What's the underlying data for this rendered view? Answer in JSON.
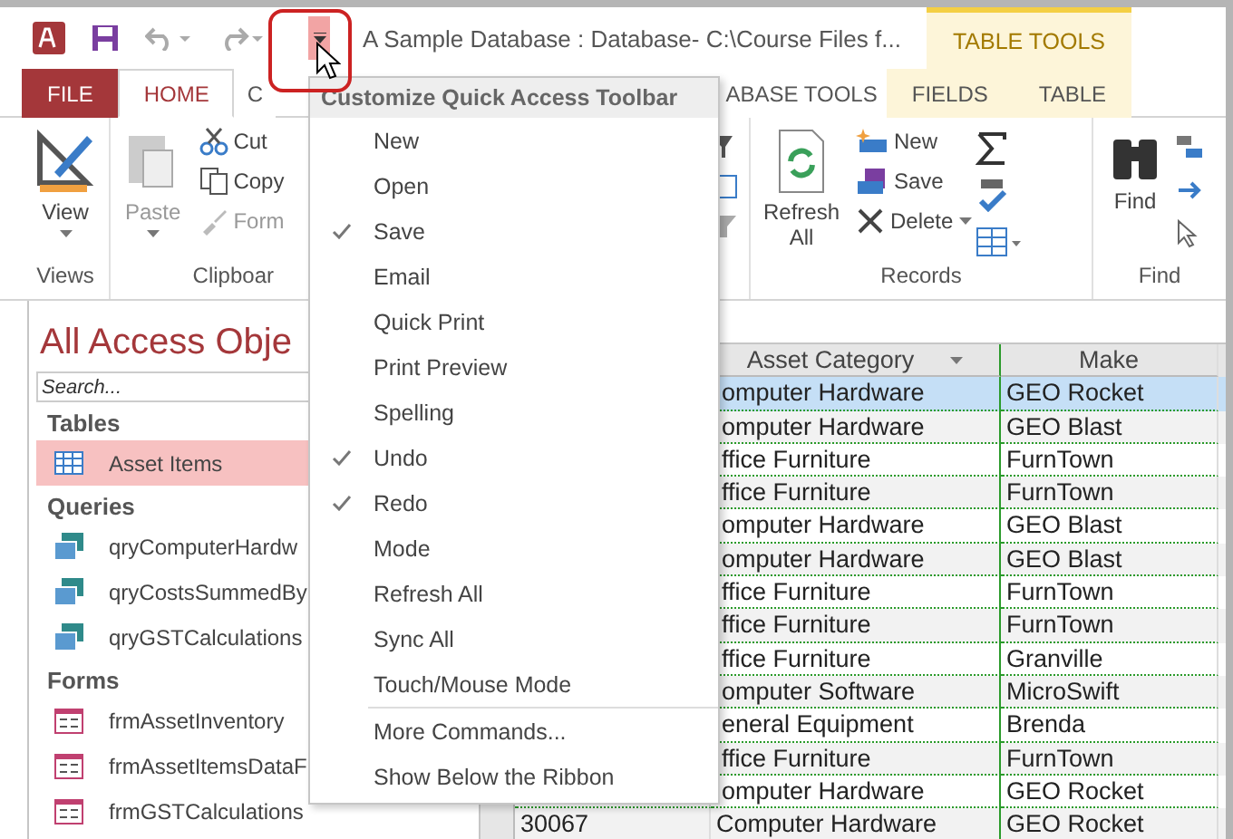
{
  "window": {
    "title": "A Sample Database : Database- C:\\Course Files f..."
  },
  "contextual_tab_group": {
    "label": "TABLE TOOLS"
  },
  "tabs": [
    {
      "label": "FILE",
      "selected": false,
      "kind": "file"
    },
    {
      "label": "HOME",
      "selected": true,
      "kind": "standard"
    },
    {
      "label": "C",
      "selected": false,
      "kind": "standard"
    },
    {
      "label": "ABASE TOOLS",
      "selected": false,
      "kind": "standard"
    },
    {
      "label": "FIELDS",
      "selected": false,
      "kind": "contextual"
    },
    {
      "label": "TABLE",
      "selected": false,
      "kind": "contextual"
    }
  ],
  "ribbon": {
    "views": {
      "label": "Views",
      "view_button": "View"
    },
    "clipboard": {
      "label": "Clipboar",
      "paste_button": "Paste",
      "cut_button": "Cut",
      "copy_button": "Copy",
      "format_button": "Form"
    },
    "records": {
      "label": "Records",
      "refresh_button": "Refresh All",
      "new_button": "New",
      "save_button": "Save",
      "delete_button": "Delete"
    },
    "find": {
      "label": "Find",
      "find_button": "Find"
    }
  },
  "navigation_pane": {
    "title": "All Access Obje",
    "search": {
      "placeholder": "Search..."
    },
    "sections": [
      {
        "title": "Tables",
        "items": [
          {
            "name": "Asset Items",
            "kind": "table",
            "selected": true
          }
        ]
      },
      {
        "title": "Queries",
        "items": [
          {
            "name": "qryComputerHardw",
            "kind": "query",
            "selected": false
          },
          {
            "name": "qryCostsSummedBy",
            "kind": "query",
            "selected": false
          },
          {
            "name": "qryGSTCalculations",
            "kind": "query",
            "selected": false
          }
        ]
      },
      {
        "title": "Forms",
        "items": [
          {
            "name": "frmAssetInventory",
            "kind": "form",
            "selected": false
          },
          {
            "name": "frmAssetItemsDataF",
            "kind": "form",
            "selected": false
          },
          {
            "name": "frmGSTCalculations",
            "kind": "form",
            "selected": false
          }
        ]
      }
    ]
  },
  "datasheet": {
    "columns": [
      "Asset Category",
      "Make"
    ],
    "rows": [
      {
        "asset_category": "omputer Hardware",
        "make": "GEO Rocket",
        "selected": true
      },
      {
        "asset_category": "omputer Hardware",
        "make": "GEO Blast",
        "selected": false
      },
      {
        "asset_category": "ffice Furniture",
        "make": "FurnTown",
        "selected": false
      },
      {
        "asset_category": "ffice Furniture",
        "make": "FurnTown",
        "selected": false
      },
      {
        "asset_category": "omputer Hardware",
        "make": "GEO Blast",
        "selected": false
      },
      {
        "asset_category": "omputer Hardware",
        "make": "GEO Blast",
        "selected": false
      },
      {
        "asset_category": "ffice Furniture",
        "make": "FurnTown",
        "selected": false
      },
      {
        "asset_category": "ffice Furniture",
        "make": "FurnTown",
        "selected": false
      },
      {
        "asset_category": "ffice Furniture",
        "make": "Granville",
        "selected": false
      },
      {
        "asset_category": "omputer Software",
        "make": "MicroSwift",
        "selected": false
      },
      {
        "asset_category": "eneral Equipment",
        "make": "Brenda",
        "selected": false
      },
      {
        "asset_category": "ffice Furniture",
        "make": "FurnTown",
        "selected": false
      },
      {
        "asset_category": "omputer Hardware",
        "make": "GEO Rocket",
        "selected": false
      },
      {
        "id": "30067",
        "asset_category": "Computer Hardware",
        "make": "GEO Rocket",
        "selected": false
      }
    ]
  },
  "menu": {
    "title": "Customize Quick Access Toolbar",
    "items": [
      {
        "label": "New",
        "kind": "toggle",
        "checked": false
      },
      {
        "label": "Open",
        "kind": "toggle",
        "checked": false
      },
      {
        "label": "Save",
        "kind": "toggle",
        "checked": true
      },
      {
        "label": "Email",
        "kind": "toggle",
        "checked": false
      },
      {
        "label": "Quick Print",
        "kind": "toggle",
        "checked": false
      },
      {
        "label": "Print Preview",
        "kind": "toggle",
        "checked": false
      },
      {
        "label": "Spelling",
        "kind": "toggle",
        "checked": false
      },
      {
        "label": "Undo",
        "kind": "toggle",
        "checked": true
      },
      {
        "label": "Redo",
        "kind": "toggle",
        "checked": true
      },
      {
        "label": "Mode",
        "kind": "toggle",
        "checked": false
      },
      {
        "label": "Refresh All",
        "kind": "toggle",
        "checked": false
      },
      {
        "label": "Sync All",
        "kind": "toggle",
        "checked": false
      },
      {
        "label": "Touch/Mouse Mode",
        "kind": "toggle",
        "checked": false
      },
      {
        "label": "More Commands...",
        "kind": "command"
      },
      {
        "label": "Show Below the Ribbon",
        "kind": "command"
      }
    ]
  }
}
